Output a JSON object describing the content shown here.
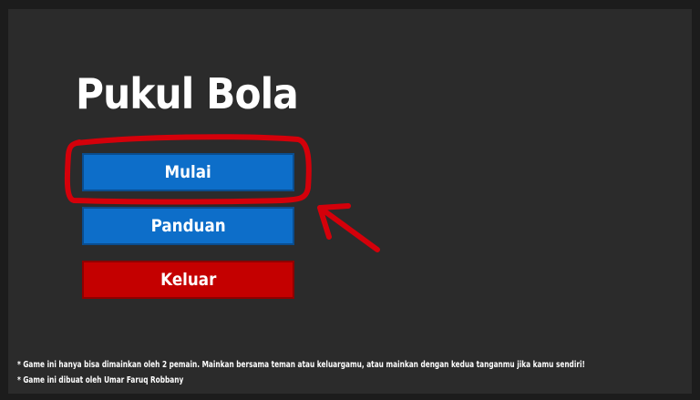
{
  "game": {
    "title": "Pukul Bola"
  },
  "menu": {
    "start_label": "Mulai",
    "guide_label": "Panduan",
    "quit_label": "Keluar"
  },
  "notes": [
    "* Game ini hanya bisa dimainkan oleh 2 pemain. Mainkan bersama teman atau keluargamu, atau mainkan dengan kedua tanganmu jika kamu sendiri!",
    "* Game ini dibuat oleh Umar Faruq Robbany"
  ],
  "colors": {
    "background": "#2b2b2b",
    "frame": "#1c1c1c",
    "button_blue": "#0d6ec9",
    "button_red": "#c40000",
    "annotation_red": "#d4000a"
  },
  "icons": {
    "highlight": "hand-drawn-circle-highlight",
    "pointer": "hand-drawn-arrow-icon"
  }
}
